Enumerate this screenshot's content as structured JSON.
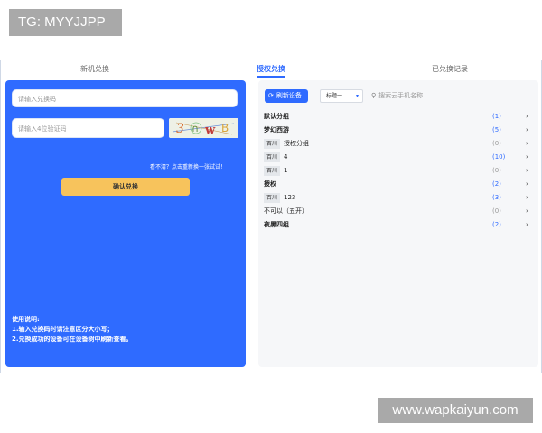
{
  "watermark_top": "TG: MYYJJPP",
  "watermark_bottom": "www.wapkaiyun.com",
  "tabs": [
    {
      "label": "新机兑换"
    },
    {
      "label": "授权兑换"
    },
    {
      "label": "已兑换记录"
    }
  ],
  "left": {
    "code_placeholder": "请输入兑换码",
    "captcha_placeholder": "请输入4位验证码",
    "captcha_text": "3 ∩ w B",
    "refresh_link": "看不清？点击重新换一张试试！",
    "confirm_label": "确认兑换",
    "usage_title": "使用说明:",
    "usage_line1": "1.输入兑换码时请注意区分大小写；",
    "usage_line2": "2.兑换成功的设备可在设备树中刷新查看。"
  },
  "right": {
    "refresh_label": "刷新设备",
    "select_value": "标题一",
    "search_placeholder": "搜索云手机名称",
    "rows": [
      {
        "tag": "",
        "label": "默认分组",
        "count": "(1)"
      },
      {
        "tag": "",
        "label": "梦幻西游",
        "count": "(5)"
      },
      {
        "tag": "百川",
        "label": "授权分组",
        "count": "(0)"
      },
      {
        "tag": "百川",
        "label": "4",
        "count": "(10)"
      },
      {
        "tag": "百川",
        "label": "1",
        "count": "(0)"
      },
      {
        "tag": "",
        "label": "授权",
        "count": "(2)"
      },
      {
        "tag": "百川",
        "label": "123",
        "count": "(3)"
      },
      {
        "tag": "",
        "label": "不可以（五开）",
        "count": "(0)"
      },
      {
        "tag": "",
        "label": "夜黑四组",
        "count": "(2)"
      }
    ]
  },
  "colors": {
    "accent": "#2f6bff",
    "confirm": "#f7c35c"
  }
}
